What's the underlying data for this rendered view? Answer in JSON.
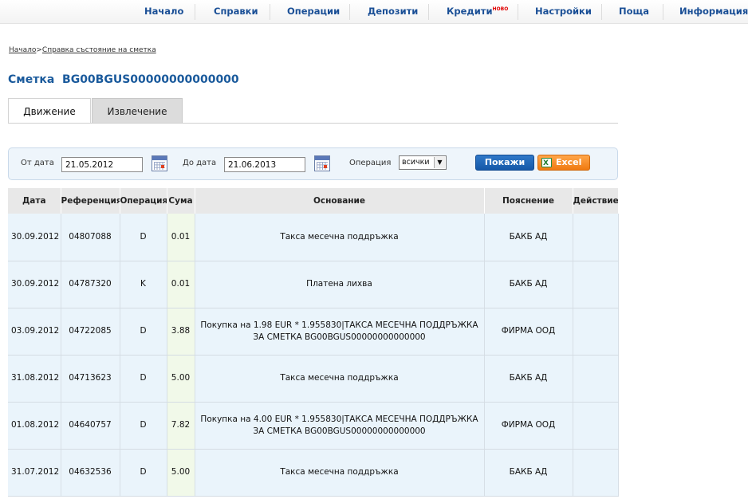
{
  "nav": [
    {
      "label": "Начало",
      "sup": ""
    },
    {
      "label": "Справки",
      "sup": ""
    },
    {
      "label": "Операции",
      "sup": ""
    },
    {
      "label": "Депозити",
      "sup": ""
    },
    {
      "label": "Кредити",
      "sup": "НОВО"
    },
    {
      "label": "Настройки",
      "sup": ""
    },
    {
      "label": "Поща",
      "sup": ""
    },
    {
      "label": "Информация",
      "sup": ""
    }
  ],
  "breadcrumb": {
    "home": "Начало",
    "separator": ">",
    "current": "Справка състояние на сметка"
  },
  "account": {
    "label": "Сметка",
    "number": "BG00BGUS00000000000000"
  },
  "tabs": {
    "movement": "Движение",
    "statement": "Извлечение"
  },
  "filter": {
    "from_label": "От дата",
    "from_value": "21.05.2012",
    "to_label": "До дата",
    "to_value": "21.06.2013",
    "operation_label": "Операция",
    "operation_value": "всички",
    "show_button": "Покажи",
    "excel_button": "Excel"
  },
  "table": {
    "headers": [
      "Дата",
      "Референция",
      "Операция",
      "Сума",
      "Основание",
      "Пояснение",
      "Действие"
    ],
    "rows": [
      {
        "date": "30.09.2012",
        "ref": "04807088",
        "op": "D",
        "amount": "0.01",
        "reason": "Такса месечна поддръжка",
        "note": "БАКБ АД"
      },
      {
        "date": "30.09.2012",
        "ref": "04787320",
        "op": "K",
        "amount": "0.01",
        "reason": "Платена лихва",
        "note": "БАКБ АД"
      },
      {
        "date": "03.09.2012",
        "ref": "04722085",
        "op": "D",
        "amount": "3.88",
        "reason": "Покупка на 1.98 EUR * 1.955830|ТАКСА МЕСЕЧНА ПОДДРЪЖКА ЗА СМЕТКА BG00BGUS00000000000000",
        "note": "ФИРМА ООД"
      },
      {
        "date": "31.08.2012",
        "ref": "04713623",
        "op": "D",
        "amount": "5.00",
        "reason": "Такса месечна поддръжка",
        "note": "БАКБ АД"
      },
      {
        "date": "01.08.2012",
        "ref": "04640757",
        "op": "D",
        "amount": "7.82",
        "reason": "Покупка на 4.00 EUR * 1.955830|ТАКСА МЕСЕЧНА ПОДДРЪЖКА ЗА СМЕТКА BG00BGUS00000000000000",
        "note": "ФИРМА ООД"
      },
      {
        "date": "31.07.2012",
        "ref": "04632536",
        "op": "D",
        "amount": "5.00",
        "reason": "Такса месечна поддръжка",
        "note": "БАКБ АД"
      }
    ]
  },
  "colors": {
    "nav_text": "#1a4f96",
    "title": "#1a5a9c",
    "show_button": "#1e66b8",
    "excel_button": "#f58a20",
    "row_bg": "#eaf4fb"
  }
}
